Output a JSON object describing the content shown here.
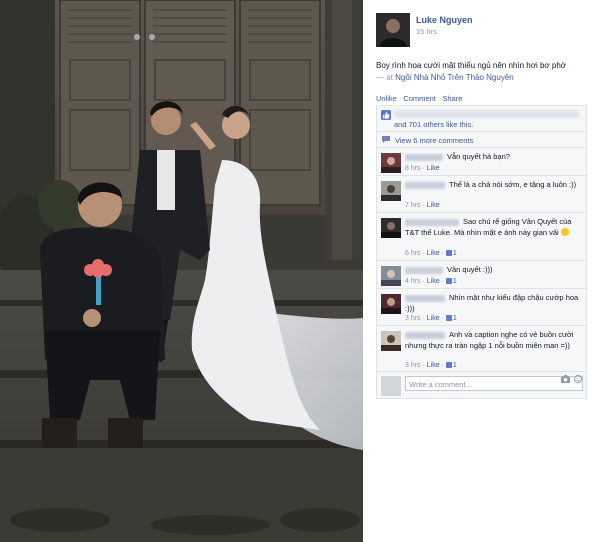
{
  "post": {
    "author": "Luke Nguyen",
    "time": "15 hrs",
    "caption": "Boy rình hoa cưới mặt thiểu ngủ nên nhìn hơi bơ phờ",
    "caption_sep": "—",
    "location_prefix": "at",
    "location": "Ngôi Nhà Nhỏ Trên Thảo Nguyên",
    "actions": {
      "like": "Unlike",
      "comment": "Comment",
      "share": "Share",
      "dot": "·"
    }
  },
  "likes": {
    "text": "and 701 others like this."
  },
  "more_comments": {
    "label": "View 6 more comments"
  },
  "comments": [
    {
      "text": "Vẫn quyết hả bạn?",
      "time": "8 hrs",
      "like": "Like",
      "count": ""
    },
    {
      "text": "Thế là a chả nói sớm, e tặng a luôn :))",
      "time": "7 hrs",
      "like": "Like",
      "count": ""
    },
    {
      "text": "Sao chú rể giống Vân Quyết của T&T thế Luke. Mà nhìn mặt e ảnh này gian vãi",
      "time": "6 hrs",
      "like": "Like",
      "count": "1"
    },
    {
      "text": "Vân quyết :)))",
      "time": "4 hrs",
      "like": "Like",
      "count": "1"
    },
    {
      "text": "Nhìn mặt như kiểu đập chậu cướp hoa :)))",
      "time": "3 hrs",
      "like": "Like",
      "count": "1"
    },
    {
      "text": "Anh và caption nghe có vẻ buồn cười nhưng thực ra tràn ngập 1 nỗi buồn miên man =))",
      "time": "3 hrs",
      "like": "Like",
      "count": "1"
    }
  ],
  "composer": {
    "placeholder": "Write a comment..."
  },
  "colors": {
    "link": "#3b5998",
    "meta": "#9197a3",
    "ufi_bg": "#f6f7f9"
  }
}
